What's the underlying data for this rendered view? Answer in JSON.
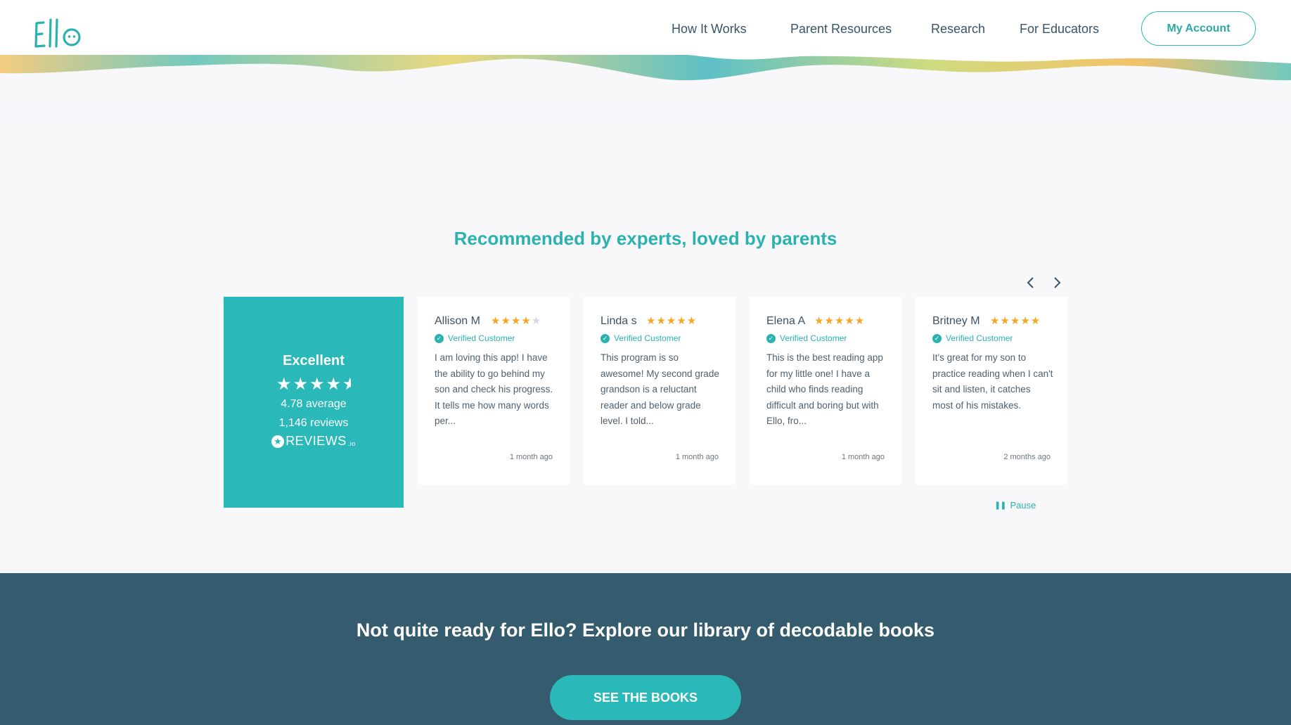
{
  "brand": {
    "logo_text": "Ello",
    "accent_color": "#2bb2b0",
    "dark_color": "#355c6e",
    "star_color": "#f5a623"
  },
  "nav": {
    "items": [
      "How It Works",
      "Parent Resources",
      "Research",
      "For Educators"
    ],
    "account_label": "My Account"
  },
  "reviews_section": {
    "title": "Recommended by experts, loved by parents",
    "prev_icon": "chevron-left-icon",
    "next_icon": "chevron-right-icon",
    "summary": {
      "rating_word": "Excellent",
      "stars": 4.5,
      "average": "4.78 average",
      "count": "1,146 reviews",
      "provider": "REVIEWS",
      "provider_suffix": ".io"
    },
    "reviews": [
      {
        "name": "Allison M",
        "rating": 4,
        "verified": "Verified Customer",
        "text": "I am loving this app! I have the ability to go behind my son and check his progress. It tells me how many words per...",
        "time": "1 month ago"
      },
      {
        "name": "Linda s",
        "rating": 5,
        "verified": "Verified Customer",
        "text": "This program is so awesome! My second grade grandson is a reluctant reader and below grade level. I told...",
        "time": "1 month ago"
      },
      {
        "name": "Elena A",
        "rating": 5,
        "verified": "Verified Customer",
        "text": "This is the best reading app for my little one! I have a child who finds reading difficult and boring but with Ello, fro...",
        "time": "1 month ago"
      },
      {
        "name": "Britney M",
        "rating": 5,
        "verified": "Verified Customer",
        "text": "It's great for my son to practice reading when I can't sit and listen, it catches most of his mistakes.",
        "time": "2 months ago"
      }
    ],
    "pause_label": "Pause"
  },
  "cta": {
    "title": "Not quite ready for Ello? Explore our library of decodable books",
    "button_label": "SEE THE BOOKS"
  }
}
